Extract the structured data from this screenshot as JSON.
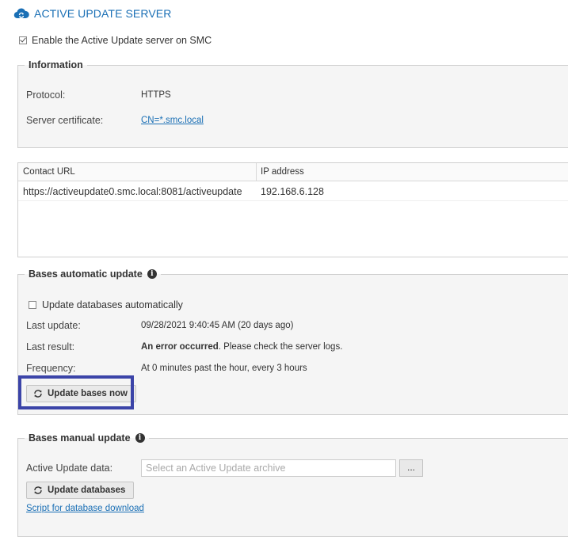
{
  "header": {
    "title": "ACTIVE UPDATE SERVER",
    "icon": "cloud-sync-icon"
  },
  "enable": {
    "label": "Enable the Active Update server on SMC",
    "checked": true
  },
  "information": {
    "legend": "Information",
    "protocol_label": "Protocol:",
    "protocol_value": "HTTPS",
    "certificate_label": "Server certificate:",
    "certificate_value": "CN=*.smc.local"
  },
  "table": {
    "columns": [
      "Contact URL",
      "IP address"
    ],
    "rows": [
      [
        "https://activeupdate0.smc.local:8081/activeupdate",
        "192.168.6.128"
      ]
    ]
  },
  "auto_update": {
    "legend": "Bases automatic update",
    "checkbox_label": "Update databases automatically",
    "checked": false,
    "last_update_label": "Last update:",
    "last_update_value": "09/28/2021 9:40:45 AM (20 days ago)",
    "last_result_label": "Last result:",
    "last_result_bold": "An error occurred",
    "last_result_rest": ". Please check the server logs.",
    "frequency_label": "Frequency:",
    "frequency_value": "At 0 minutes past the hour, every 3 hours",
    "button_label": "Update bases now"
  },
  "manual_update": {
    "legend": "Bases manual update",
    "data_label": "Active Update data:",
    "input_placeholder": "Select an Active Update archive",
    "browse_label": "...",
    "button_label": "Update databases",
    "script_link": "Script for database download"
  },
  "colors": {
    "accent": "#1a6fb5",
    "highlight": "#3b44a8"
  }
}
